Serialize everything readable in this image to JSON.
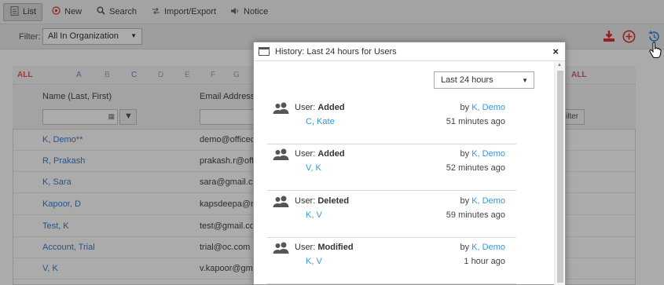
{
  "toolbar": {
    "items": [
      {
        "label": "List",
        "icon": "list-icon",
        "active": true
      },
      {
        "label": "New",
        "icon": "plus-circle-icon"
      },
      {
        "label": "Search",
        "icon": "search-icon"
      },
      {
        "label": "Import/Export",
        "icon": "import-export-icon"
      },
      {
        "label": "Notice",
        "icon": "speaker-icon"
      }
    ]
  },
  "filter": {
    "label": "Filter:",
    "selected": "All In Organization"
  },
  "actions": {
    "download_icon": "download-icon",
    "add_icon": "add-circle-icon",
    "history_icon": "history-icon",
    "accent_red": "#e03030",
    "accent_blue": "#3a84d0"
  },
  "alphabet": {
    "left_all": "ALL",
    "letters": [
      "A",
      "B",
      "C",
      "D",
      "E",
      "F",
      "G"
    ],
    "right_all": "ALL"
  },
  "table": {
    "col_name": "Name (Last, First)",
    "col_email": "Email Address",
    "filter_button": "ilter",
    "rows": [
      {
        "name": "K, Demo**",
        "email": "demo@officec"
      },
      {
        "name": "R, Prakash",
        "email": "prakash.r@off"
      },
      {
        "name": "K, Sara",
        "email": "sara@gmail.cc"
      },
      {
        "name": "Kapoor, D",
        "email": "kapsdeepa@r"
      },
      {
        "name": "Test, K",
        "email": "test@gmail.co"
      },
      {
        "name": "Account, Trial",
        "email": "trial@oc.com"
      },
      {
        "name": "V, K",
        "email": "v.kapoor@gm"
      }
    ]
  },
  "modal": {
    "title": "History: Last 24 hours for Users",
    "close": "×",
    "range_selected": "Last 24 hours",
    "entries": [
      {
        "prefix": "User:",
        "action": "Added",
        "subject": "C, Kate",
        "by_prefix": "by",
        "by": "K, Demo",
        "time": "51 minutes ago"
      },
      {
        "prefix": "User:",
        "action": "Added",
        "subject": "V, K",
        "by_prefix": "by",
        "by": "K, Demo",
        "time": "52 minutes ago"
      },
      {
        "prefix": "User:",
        "action": "Deleted",
        "subject": "K, V",
        "by_prefix": "by",
        "by": "K, Demo",
        "time": "59 minutes ago"
      },
      {
        "prefix": "User:",
        "action": "Modified",
        "subject": "K, V",
        "by_prefix": "by",
        "by": "K, Demo",
        "time": "1 hour ago"
      }
    ]
  }
}
